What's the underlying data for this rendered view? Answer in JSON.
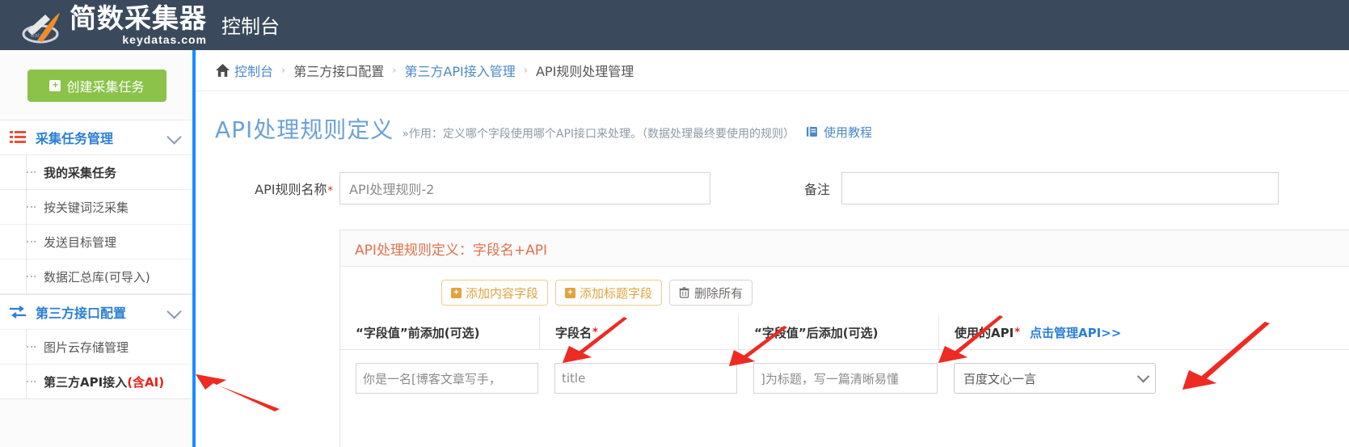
{
  "header": {
    "logo_cn": "简数采集器",
    "logo_en": "keydatas.com",
    "console_title": "控制台"
  },
  "sidebar": {
    "create_button": "创建采集任务",
    "groups": [
      {
        "label": "采集任务管理",
        "icon": "list-icon",
        "items": [
          {
            "label": "我的采集任务",
            "active": true
          },
          {
            "label": "按关键词泛采集",
            "active": false
          },
          {
            "label": "发送目标管理",
            "active": false
          },
          {
            "label": "数据汇总库(可导入)",
            "active": false
          }
        ]
      },
      {
        "label": "第三方接口配置",
        "icon": "exchange-icon",
        "items": [
          {
            "label": "图片云存储管理",
            "active": false
          },
          {
            "label": "第三方API接入",
            "suffix": "(含AI)",
            "active": true
          }
        ]
      }
    ]
  },
  "breadcrumb": {
    "home_icon": "home-icon",
    "items": [
      "控制台",
      "第三方接口配置",
      "第三方API接入管理",
      "API规则处理管理"
    ],
    "separator": "›"
  },
  "page": {
    "title": "API处理规则定义",
    "description": "»作用：定义哪个字段使用哪个API接口来处理。（数据处理最终要使用的规则）",
    "tutorial_link": "使用教程",
    "tutorial_icon": "book-icon"
  },
  "form": {
    "rule_name_label": "API规则名称",
    "rule_name_required": "*",
    "rule_name_value": "API处理规则-2",
    "remark_label": "备注",
    "remark_value": ""
  },
  "fieldset": {
    "legend": "API处理规则定义：字段名+API",
    "buttons": [
      {
        "label": "添加内容字段",
        "icon": "plus-square-icon",
        "style": "orange"
      },
      {
        "label": "添加标题字段",
        "icon": "plus-square-icon",
        "style": "orange"
      },
      {
        "label": "删除所有",
        "icon": "trash-icon",
        "style": "gray"
      }
    ],
    "table": {
      "headers": [
        {
          "text": "“字段值”前添加(可选)",
          "required": ""
        },
        {
          "text": "字段名",
          "required": "*"
        },
        {
          "text": "“字段值”后添加(可选)",
          "required": ""
        },
        {
          "text": "使用的API",
          "required": "*",
          "link": "点击管理API>>"
        }
      ],
      "rows": [
        {
          "prefix": "你是一名[博客文章写手，",
          "field_name": "title",
          "suffix": "]为标题，写一篇清晰易懂",
          "api": "百度文心一言"
        }
      ]
    }
  },
  "annotations": {
    "arrow_color": "#ee2b22",
    "count": 5
  },
  "colors": {
    "header_bg": "#3a4a5c",
    "accent_blue": "#1a8cff",
    "link_blue": "#2b7fd4",
    "green": "#8bc34a",
    "orange": "#e0a33f",
    "title_blue": "#6aa2d8",
    "legend_orange": "#e2714b",
    "required_red": "#e8221c"
  }
}
